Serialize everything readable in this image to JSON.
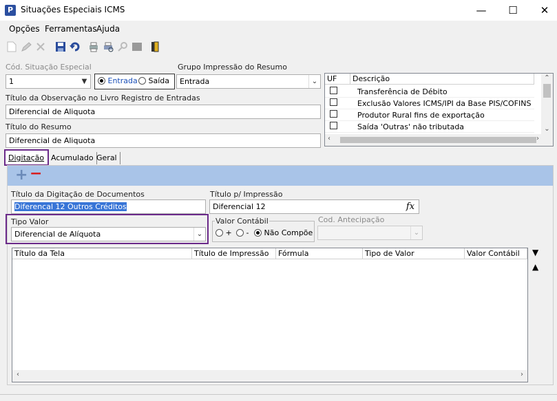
{
  "window": {
    "title": "Situações Especiais ICMS",
    "minimize": "—",
    "maximize": "☐",
    "close": "✕"
  },
  "menu": {
    "items": [
      "Opções",
      "Ferramentas",
      "Ajuda"
    ]
  },
  "form": {
    "cod_label": "Cód. Situação Especial",
    "cod_value": "1",
    "entrada_label": "Entrada",
    "saida_label": "Saída",
    "grupo_label": "Grupo Impressão do Resumo",
    "grupo_value": "Entrada",
    "obs_label": "Título da Observação no Livro Registro de Entradas",
    "obs_value": "Diferencial de Aliquota",
    "resumo_label": "Título do Resumo",
    "resumo_value": "Diferencial de Aliquota"
  },
  "uf_grid": {
    "col_uf": "UF",
    "col_desc": "Descrição",
    "rows": [
      "Transferência de Débito",
      "Exclusão Valores ICMS/IPI da Base PIS/COFINS",
      "Produtor Rural fins de exportação",
      "Saída 'Outras' não tributada"
    ]
  },
  "tabs": {
    "digitacao": "Digitação",
    "acumulado": "Acumulado",
    "geral": "Geral"
  },
  "tab_panel": {
    "add": "+",
    "remove": "−",
    "titulo_dig_label": "Título da Digitação de Documentos",
    "titulo_dig_value": "Diferencal 12 Outros Créditos",
    "titulo_imp_label": "Título p/ Impressão",
    "titulo_imp_value": "Diferencial 12",
    "fx": "fx",
    "tipo_valor_label": "Tipo Valor",
    "tipo_valor_value": "Diferencial de Alíquota",
    "valor_contabil_label": "Valor Contábil",
    "plus_label": "+",
    "minus_label": "-",
    "nao_compoe_label": "Não Compõe",
    "cod_antecipacao_label": "Cod. Antecipação"
  },
  "main_grid": {
    "columns": [
      "Título da Tela",
      "Título de Impressão",
      "Fórmula",
      "Tipo de Valor",
      "Valor Contábil"
    ]
  }
}
